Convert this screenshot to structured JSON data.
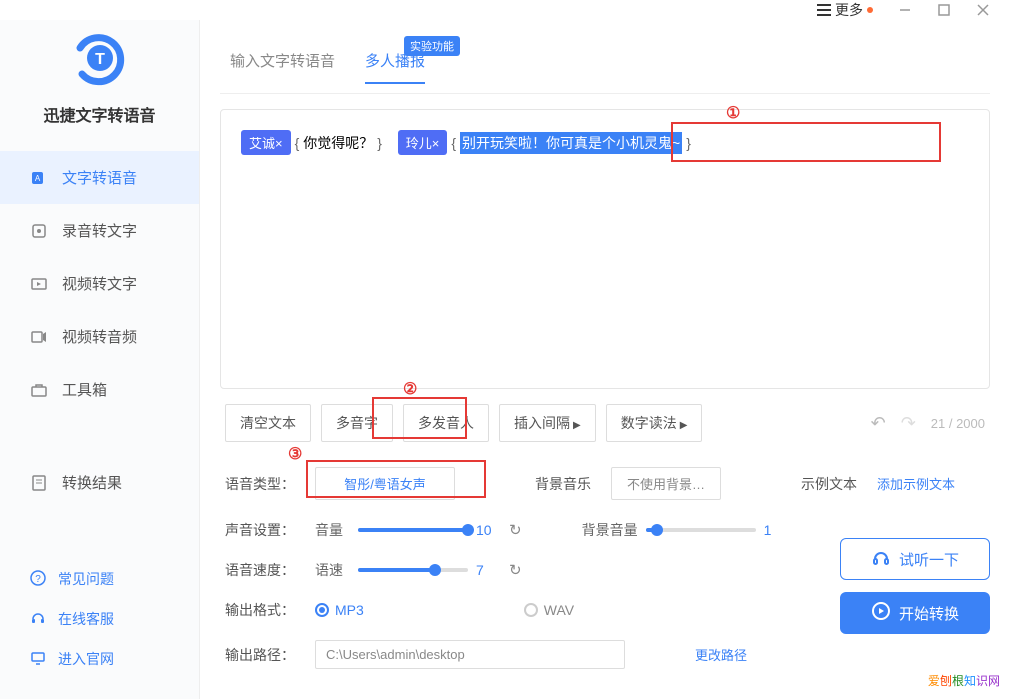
{
  "titlebar": {
    "more": "更多"
  },
  "app": {
    "name": "迅捷文字转语音"
  },
  "sidebar": {
    "items": [
      {
        "label": "文字转语音"
      },
      {
        "label": "录音转文字"
      },
      {
        "label": "视频转文字"
      },
      {
        "label": "视频转音频"
      },
      {
        "label": "工具箱"
      },
      {
        "label": "转换结果"
      }
    ],
    "footer": [
      {
        "label": "常见问题"
      },
      {
        "label": "在线客服"
      },
      {
        "label": "进入官网"
      }
    ]
  },
  "tabs": {
    "tab1": "输入文字转语音",
    "tab2": "多人播报",
    "badge": "实验功能"
  },
  "editor": {
    "speaker1": "艾诚×",
    "text1": "你觉得呢？",
    "speaker2": "玲儿×",
    "text2_sel": "别开玩笑啦！你可真是个小机灵鬼~",
    "annot1": "①",
    "annot2": "②",
    "annot3": "③"
  },
  "toolbar": {
    "clear": "清空文本",
    "polyphone": "多音字",
    "speakers": "多发音人",
    "pause": "插入间隔",
    "numread": "数字读法",
    "count": "21 / 2000"
  },
  "settings": {
    "voice_type_label": "语音类型：",
    "voice_type_value": "智彤/粤语女声",
    "bgm_label": "背景音乐",
    "bgm_value": "不使用背景…",
    "sample_label": "示例文本",
    "sample_link": "添加示例文本",
    "sound_label": "声音设置：",
    "volume_label": "音量",
    "volume_value": "10",
    "bgm_vol_label": "背景音量",
    "bgm_vol_value": "1",
    "speed_label": "语音速度：",
    "speed_sub": "语速",
    "speed_value": "7",
    "format_label": "输出格式：",
    "format_mp3": "MP3",
    "format_wav": "WAV",
    "path_label": "输出路径：",
    "path_value": "C:\\Users\\admin\\desktop",
    "change_path": "更改路径"
  },
  "actions": {
    "preview": "试听一下",
    "convert": "开始转换"
  },
  "watermark": "爱刨根知识网"
}
